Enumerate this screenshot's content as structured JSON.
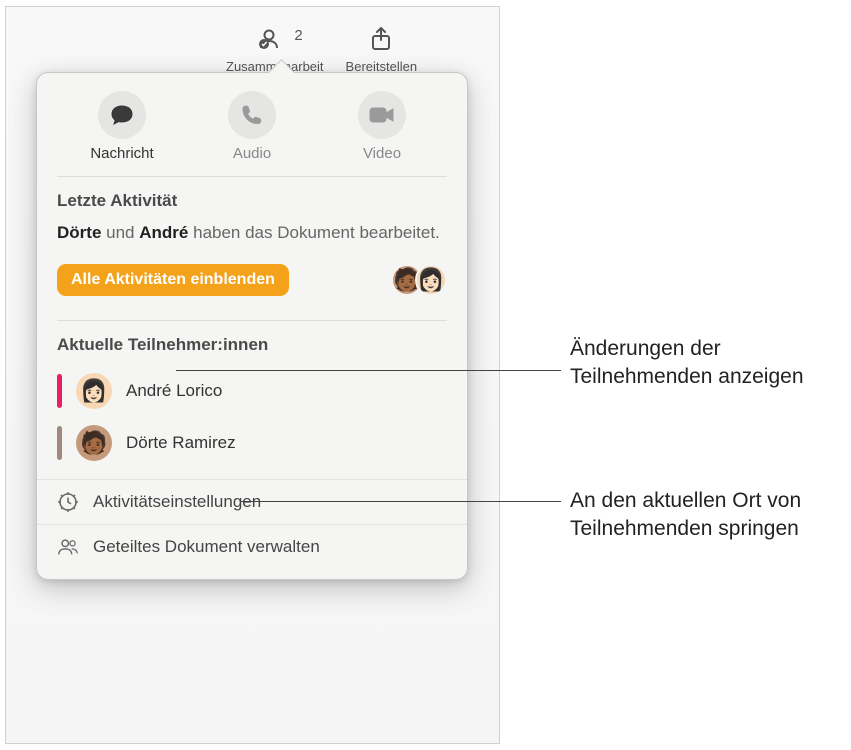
{
  "toolbar": {
    "collaboration_label": "Zusammenarbeit",
    "collaboration_count": "2",
    "share_label": "Bereitstellen"
  },
  "comm": {
    "message": "Nachricht",
    "audio": "Audio",
    "video": "Video"
  },
  "recent": {
    "heading": "Letzte Aktivität",
    "name1": "Dörte",
    "and": "und",
    "name2": "André",
    "suffix": "haben das Dokument bearbeitet.",
    "show_all": "Alle Aktivitäten einblenden"
  },
  "participants": {
    "heading": "Aktuelle Teilnehmer:innen",
    "list": [
      {
        "name": "André Lorico",
        "color": "#e91e63",
        "bg": "#f8d7b5",
        "face": "👩🏻"
      },
      {
        "name": "Dörte Ramirez",
        "color": "#a1887f",
        "bg": "#c49a7a",
        "face": "🧑🏾"
      }
    ]
  },
  "footer": {
    "activity_settings": "Aktivitätseinstellungen",
    "manage_shared": "Geteiltes Dokument verwalten"
  },
  "callouts": {
    "changes": "Änderungen der Teilnehmenden anzeigen",
    "jump": "An den aktuellen Ort von Teilnehmenden springen"
  }
}
